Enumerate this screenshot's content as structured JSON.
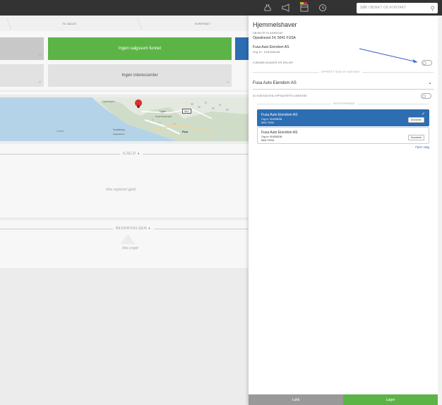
{
  "topbar": {
    "search_placeholder": "SØK OBJEKT OG KONTAKT",
    "icons": [
      "moneybag-icon",
      "megaphone-icon",
      "calendar-icon",
      "history-icon",
      "search-icon"
    ]
  },
  "steps": {
    "items": [
      "TIL SALGS",
      "KONTRAKT"
    ]
  },
  "tiles": {
    "salgssum": "Ingen salgssum funnet",
    "interessenter": "Ingen interessenter"
  },
  "map": {
    "labels": [
      "Opsahaget",
      "Lygre",
      "Hagenkrappsgate",
      "Fuskeberg",
      "Sagabakken",
      "Fusa",
      "Leirvik"
    ],
    "road": "552"
  },
  "sections": {
    "gjeld_label": "GJELD",
    "gjeld_empty": "Ikke registrert gjeld",
    "beskrivelsen_label": "BESKRIVELSEN",
    "beskrivelsen_empty": "Ikke angitt"
  },
  "panel": {
    "title": "Hjemmelshaver",
    "address_label": "OBJEKTETS ADRESSE",
    "address": "Opsalneset 24, 5641 FUSA",
    "owner_name": "Fusa Auto Eiendom AS",
    "owner_org": "Org.nr: 916036036",
    "deler_label": "HJEMMELSHAVER ER DELIER",
    "opprett_label": "OPPRETT SOM NY KONTAKT",
    "select_value": "Fusa Auto Eiendom AS",
    "upp_label": "GI KONTAKTEN OPPDATERTE ADRESSE",
    "eksisterende_label": "EKSISTERENDE",
    "cards": [
      {
        "name": "Fusa Auto Eiendom AS",
        "org": "Org.nr: 916036036",
        "place": "5641 FUSA",
        "button": "Grunninfo",
        "selected": true
      },
      {
        "name": "Fusa Auto Eiendom AS",
        "org": "Org.nr: 916036236",
        "place": "5641 FUSA",
        "button": "Grunninfo",
        "selected": false
      }
    ],
    "fjern_valg": "Fjern valg",
    "lukk": "Lukk",
    "lagre": "Lagre"
  },
  "colors": {
    "accent_blue": "#2d6db2",
    "green": "#5cb446",
    "topbar": "#333333"
  }
}
